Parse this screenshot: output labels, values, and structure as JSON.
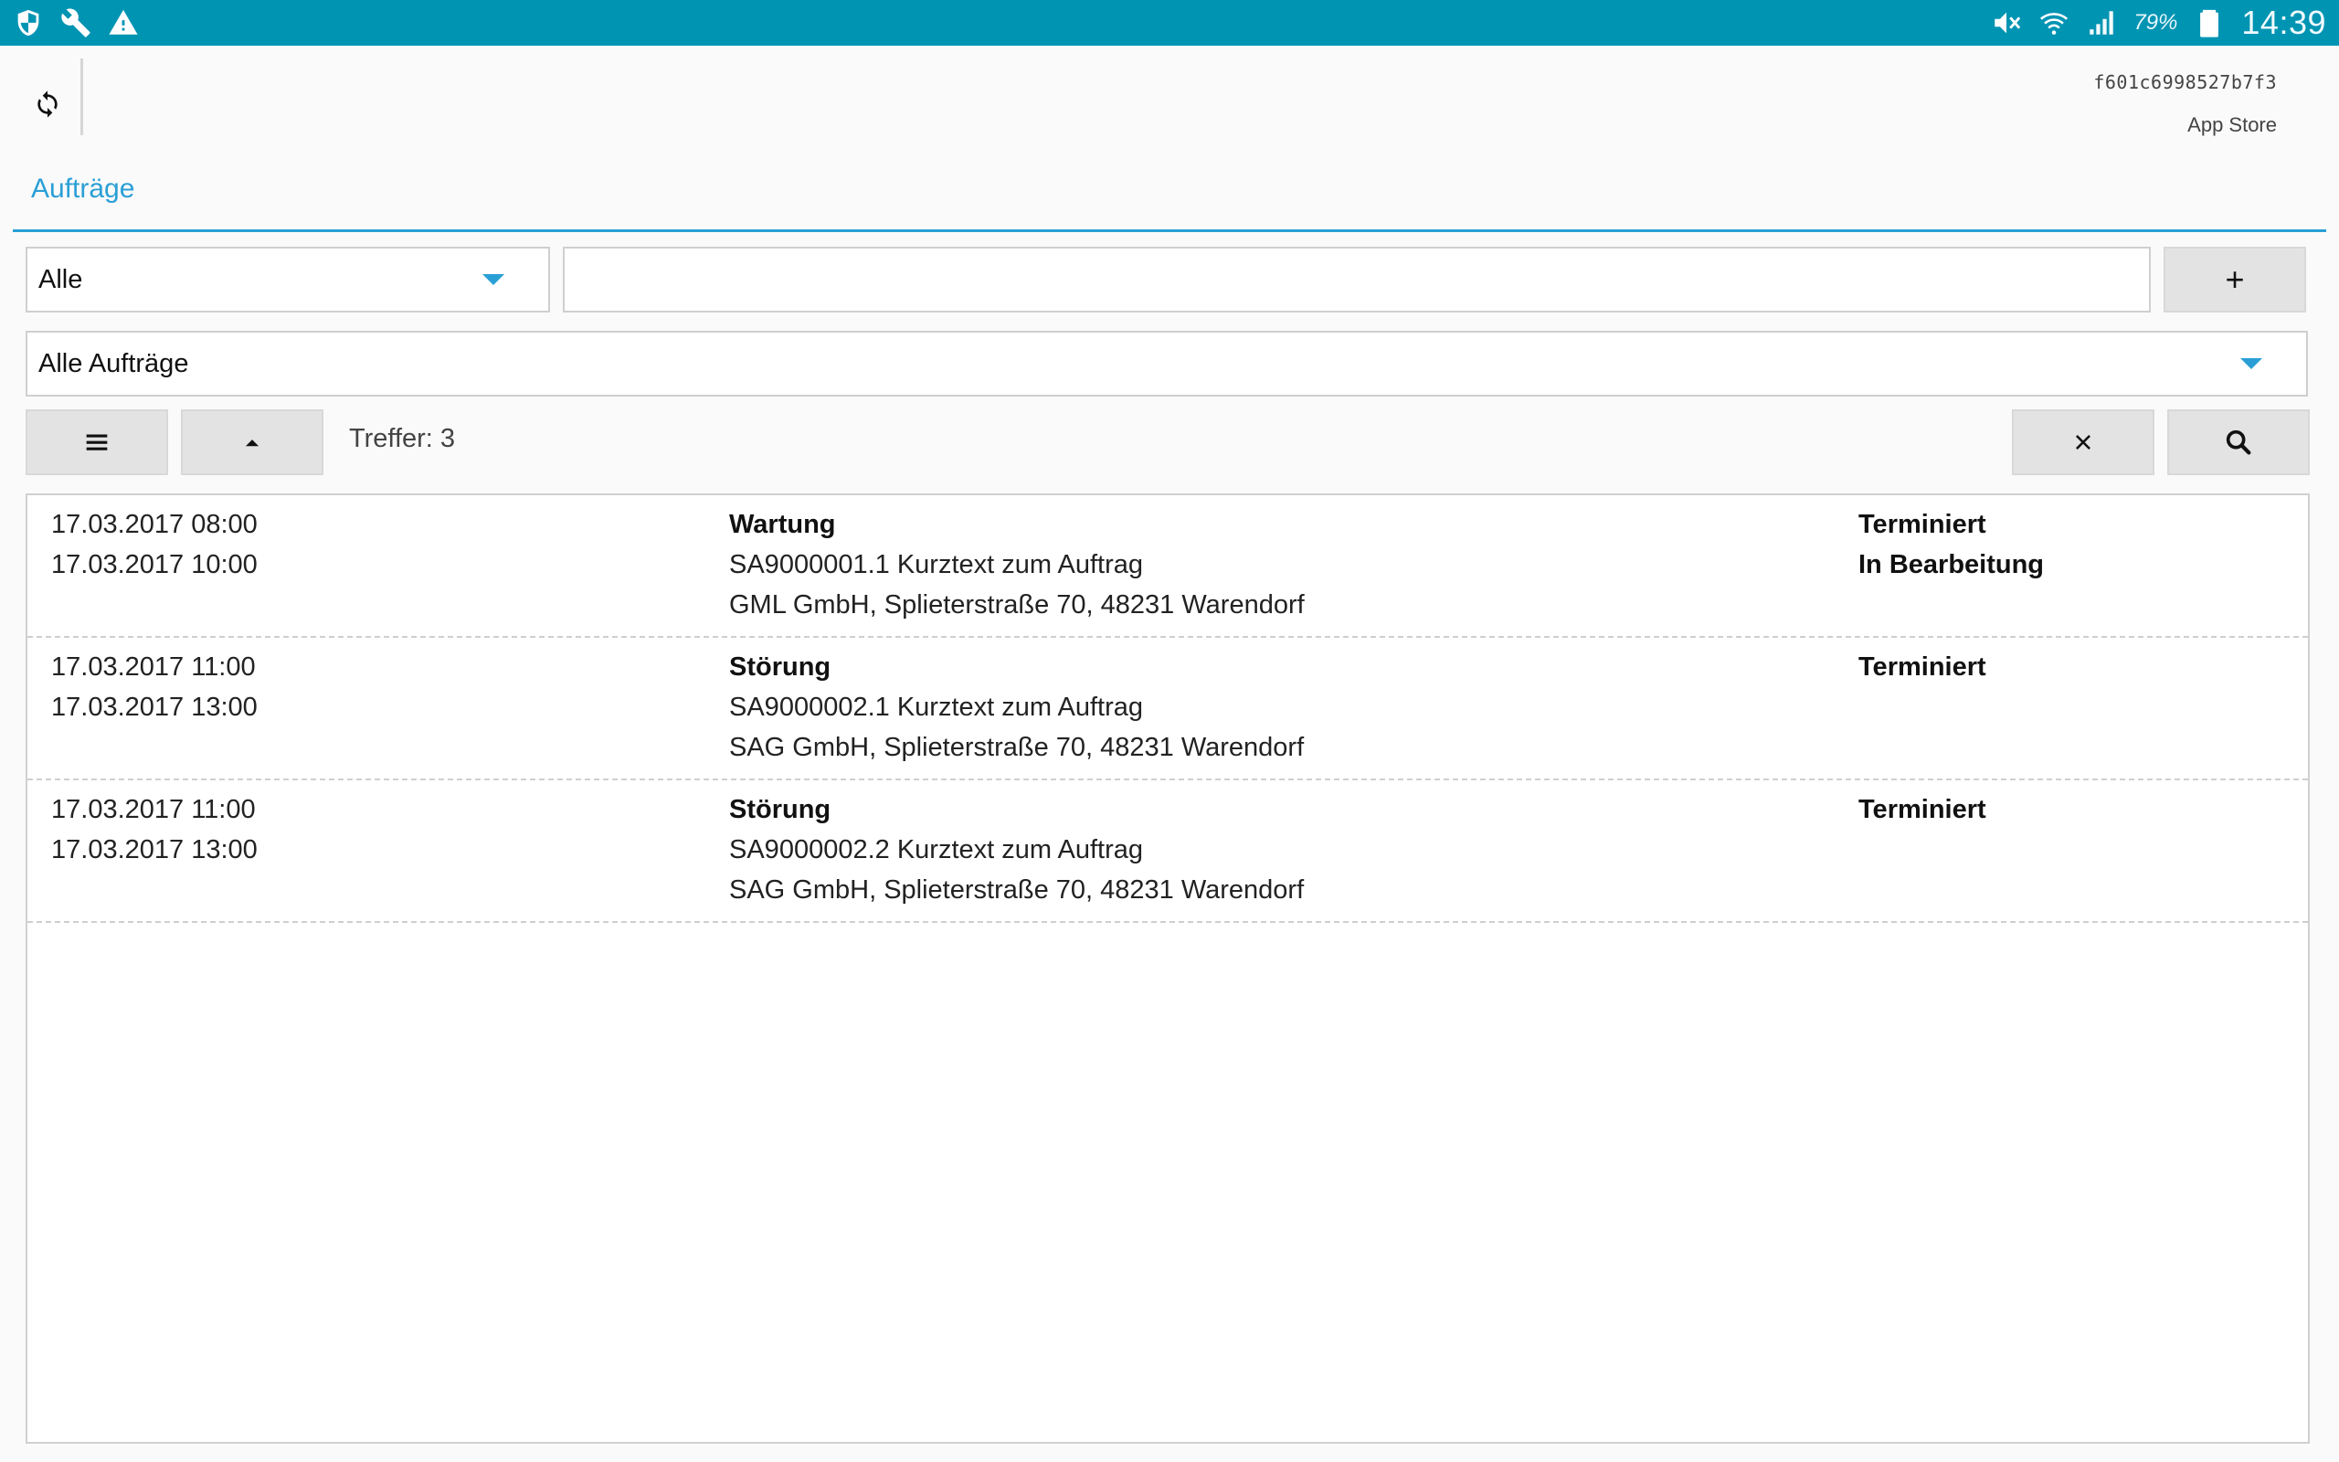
{
  "statusbar": {
    "left_icons": [
      "shield-icon",
      "wrench-icon",
      "warning-icon"
    ],
    "right_icons": [
      "mute-icon",
      "wifi-icon",
      "signal-icon",
      "battery-icon"
    ],
    "battery_percent": "79%",
    "time": "14:39",
    "background": "#0094b3"
  },
  "header": {
    "device_id": "f601c6998527b7f3",
    "app_store_label": "App Store"
  },
  "tab": {
    "title": "Aufträge",
    "accent": "#2a9fd6"
  },
  "filters": {
    "scope_select": "Alle",
    "search_value": "",
    "orders_select": "Alle Aufträge",
    "add_label": "+"
  },
  "toolbar": {
    "hits_text": "Treffer: 3"
  },
  "orders": [
    {
      "start": "17.03.2017 08:00",
      "end": "17.03.2017 10:00",
      "type": "Wartung",
      "ref": "SA9000001.1 Kurztext zum Auftrag",
      "address": "GML GmbH, Splieterstraße 70, 48231 Warendorf",
      "status1": "Terminiert",
      "status2": "In Bearbeitung"
    },
    {
      "start": "17.03.2017 11:00",
      "end": "17.03.2017 13:00",
      "type": "Störung",
      "ref": "SA9000002.1 Kurztext zum Auftrag",
      "address": "SAG GmbH, Splieterstraße 70, 48231 Warendorf",
      "status1": "Terminiert",
      "status2": ""
    },
    {
      "start": "17.03.2017 11:00",
      "end": "17.03.2017 13:00",
      "type": "Störung",
      "ref": "SA9000002.2 Kurztext zum Auftrag",
      "address": "SAG GmbH, Splieterstraße 70, 48231 Warendorf",
      "status1": "Terminiert",
      "status2": ""
    }
  ]
}
